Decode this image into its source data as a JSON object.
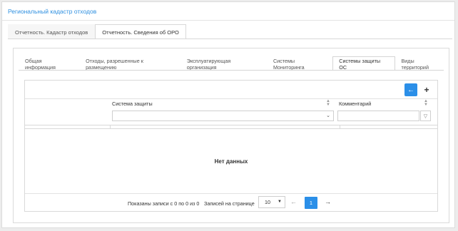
{
  "app": {
    "title": "Региональный кадастр отходов"
  },
  "top_tabs": [
    {
      "label": "Отчетность. Кадастр отходов"
    },
    {
      "label": "Отчетность. Сведения об ОРО"
    }
  ],
  "inner_tabs": [
    {
      "label": "Общая информация"
    },
    {
      "label": "Отходы, разрешенные к размещению"
    },
    {
      "label": "Эксплуатирующая организация"
    },
    {
      "label": "Системы Мониторинга"
    },
    {
      "label": "Системы защиты ОС"
    },
    {
      "label": "Виды территорий"
    }
  ],
  "toolbar": {
    "back_icon": "arrow-left-icon",
    "add_icon": "plus-icon"
  },
  "grid": {
    "columns": [
      {
        "label": "Система защиты"
      },
      {
        "label": "Комментарий"
      }
    ],
    "empty_text": "Нет данных"
  },
  "pager": {
    "info": "Показаны записи с 0 по 0 из 0",
    "per_page_label": "Записей на странице",
    "per_page_value": "10",
    "current_page": "1"
  },
  "colors": {
    "accent": "#2b8fe8",
    "title": "#2d8fe0"
  }
}
